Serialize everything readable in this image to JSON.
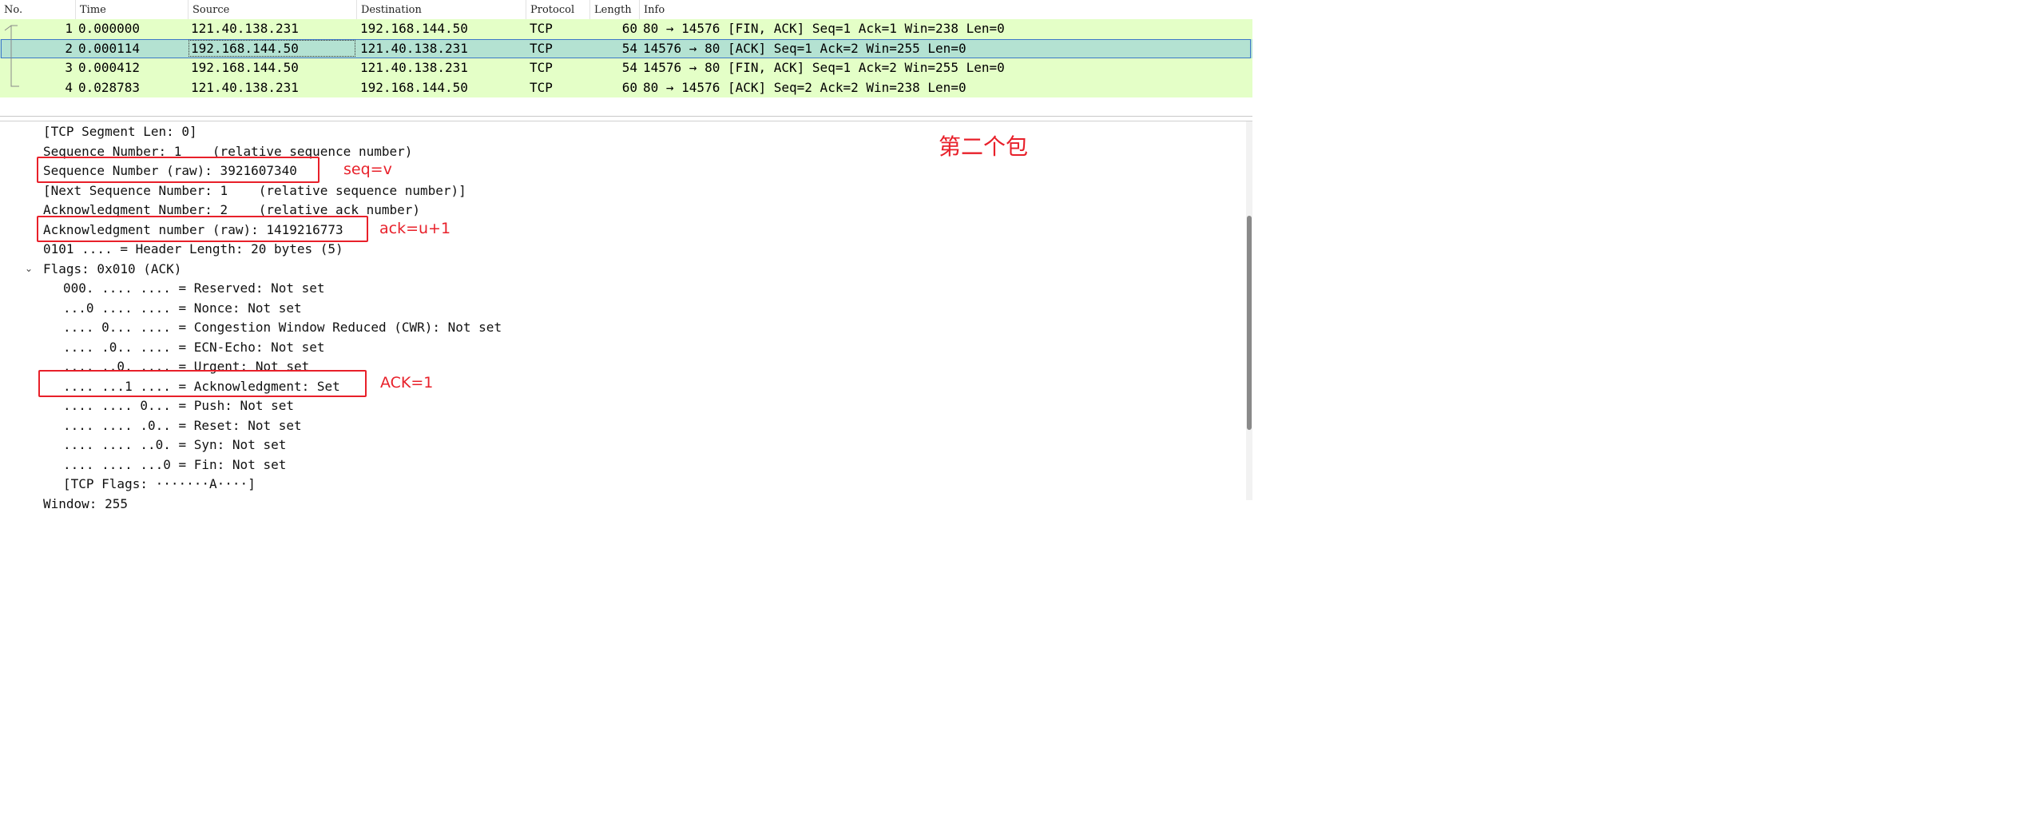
{
  "packet_list": {
    "columns": [
      "No.",
      "Time",
      "Source",
      "Destination",
      "Protocol",
      "Length",
      "Info"
    ],
    "rows": [
      {
        "no": "1",
        "time": "0.000000",
        "source": "121.40.138.231",
        "destination": "192.168.144.50",
        "protocol": "TCP",
        "length": "60",
        "info": "80 → 14576 [FIN, ACK] Seq=1 Ack=1 Win=238 Len=0",
        "selected": false
      },
      {
        "no": "2",
        "time": "0.000114",
        "source": "192.168.144.50",
        "destination": "121.40.138.231",
        "protocol": "TCP",
        "length": "54",
        "info": "14576 → 80 [ACK] Seq=1 Ack=2 Win=255 Len=0",
        "selected": true
      },
      {
        "no": "3",
        "time": "0.000412",
        "source": "192.168.144.50",
        "destination": "121.40.138.231",
        "protocol": "TCP",
        "length": "54",
        "info": "14576 → 80 [FIN, ACK] Seq=1 Ack=2 Win=255 Len=0",
        "selected": false
      },
      {
        "no": "4",
        "time": "0.028783",
        "source": "121.40.138.231",
        "destination": "192.168.144.50",
        "protocol": "TCP",
        "length": "60",
        "info": "80 → 14576 [ACK] Seq=2 Ack=2 Win=238 Len=0",
        "selected": false
      }
    ],
    "row_colors": {
      "normal": "#e4ffc7",
      "selected": "#b4e2d2"
    }
  },
  "details": {
    "lines": [
      "[TCP Segment Len: 0]",
      "Sequence Number: 1    (relative sequence number)",
      "Sequence Number (raw): 3921607340",
      "[Next Sequence Number: 1    (relative sequence number)]",
      "Acknowledgment Number: 2    (relative ack number)",
      "Acknowledgment number (raw): 1419216773",
      "0101 .... = Header Length: 20 bytes (5)",
      "Flags: 0x010 (ACK)",
      "000. .... .... = Reserved: Not set",
      "...0 .... .... = Nonce: Not set",
      ".... 0... .... = Congestion Window Reduced (CWR): Not set",
      ".... .0.. .... = ECN-Echo: Not set",
      ".... ..0. .... = Urgent: Not set",
      ".... ...1 .... = Acknowledgment: Set",
      ".... .... 0... = Push: Not set",
      ".... .... .0.. = Reset: Not set",
      ".... .... ..0. = Syn: Not set",
      ".... .... ...0 = Fin: Not set",
      "[TCP Flags: ·······A····]",
      "Window: 255"
    ],
    "expander_glyph": "⌄"
  },
  "annotations": {
    "title": "第二个包",
    "seq_note": "seq=v",
    "ack_note": "ack=u+1",
    "flag_note": "ACK=1",
    "color": "#e8202a"
  }
}
